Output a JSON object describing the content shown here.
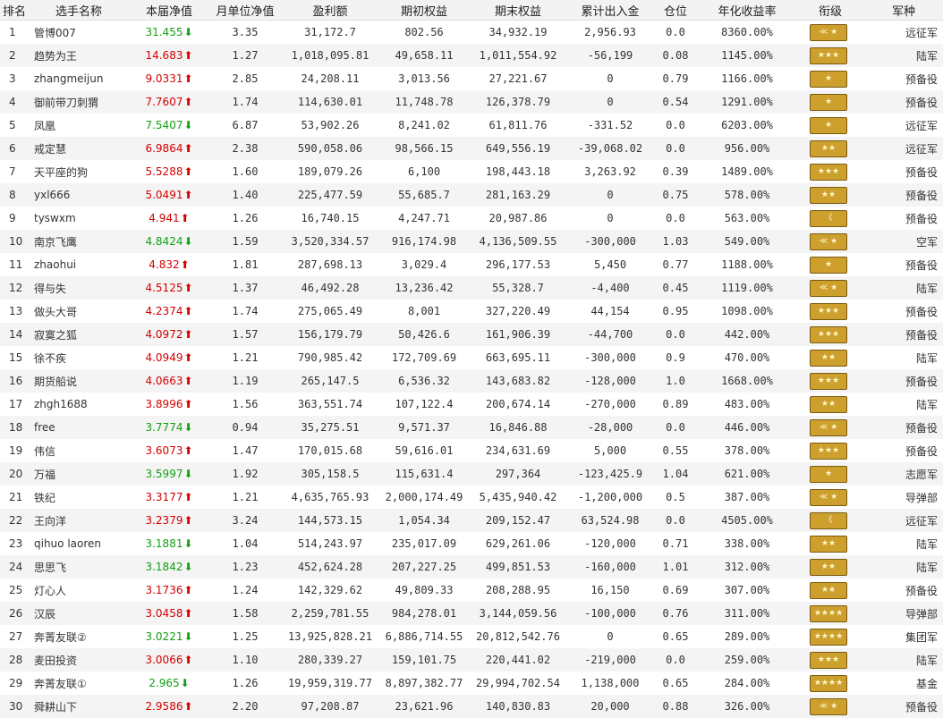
{
  "headers": [
    "排名",
    "选手名称",
    "本届净值",
    "月单位净值",
    "盈利额",
    "期初权益",
    "期末权益",
    "累计出入金",
    "仓位",
    "年化收益率",
    "衔级",
    "军种"
  ],
  "rows": [
    {
      "rank": "1",
      "name": "管博007",
      "nav": "31.455",
      "dir": "down",
      "arrow": "⬇",
      "unit": "3.35",
      "profit": "31,172.7",
      "start": "802.56",
      "end": "34,932.19",
      "cash": "2,956.93",
      "pos": "0.0",
      "annual": "8360.00%",
      "badge": "≪ ★",
      "branch": "远征军"
    },
    {
      "rank": "2",
      "name": "趋势为王",
      "nav": "14.683",
      "dir": "up",
      "arrow": "⬆",
      "unit": "1.27",
      "profit": "1,018,095.81",
      "start": "49,658.11",
      "end": "1,011,554.92",
      "cash": "-56,199",
      "pos": "0.08",
      "annual": "1145.00%",
      "badge": "★★★",
      "branch": "陆军"
    },
    {
      "rank": "3",
      "name": "zhangmeijun",
      "nav": "9.0331",
      "dir": "up",
      "arrow": "⬆",
      "unit": "2.85",
      "profit": "24,208.11",
      "start": "3,013.56",
      "end": "27,221.67",
      "cash": "0",
      "pos": "0.79",
      "annual": "1166.00%",
      "badge": "★",
      "branch": "预备役"
    },
    {
      "rank": "4",
      "name": "御前带刀刺猬",
      "nav": "7.7607",
      "dir": "up",
      "arrow": "⬆",
      "unit": "1.74",
      "profit": "114,630.01",
      "start": "11,748.78",
      "end": "126,378.79",
      "cash": "0",
      "pos": "0.54",
      "annual": "1291.00%",
      "badge": "★",
      "branch": "预备役"
    },
    {
      "rank": "5",
      "name": "凤凰",
      "nav": "7.5407",
      "dir": "down",
      "arrow": "⬇",
      "unit": "6.87",
      "profit": "53,902.26",
      "start": "8,241.02",
      "end": "61,811.76",
      "cash": "-331.52",
      "pos": "0.0",
      "annual": "6203.00%",
      "badge": "★",
      "branch": "远征军"
    },
    {
      "rank": "6",
      "name": "戒定慧",
      "nav": "6.9864",
      "dir": "up",
      "arrow": "⬆",
      "unit": "2.38",
      "profit": "590,058.06",
      "start": "98,566.15",
      "end": "649,556.19",
      "cash": "-39,068.02",
      "pos": "0.0",
      "annual": "956.00%",
      "badge": "★★",
      "branch": "远征军"
    },
    {
      "rank": "7",
      "name": "天平座的狗",
      "nav": "5.5288",
      "dir": "up",
      "arrow": "⬆",
      "unit": "1.60",
      "profit": "189,079.26",
      "start": "6,100",
      "end": "198,443.18",
      "cash": "3,263.92",
      "pos": "0.39",
      "annual": "1489.00%",
      "badge": "★★★",
      "branch": "预备役"
    },
    {
      "rank": "8",
      "name": "yxl666",
      "nav": "5.0491",
      "dir": "up",
      "arrow": "⬆",
      "unit": "1.40",
      "profit": "225,477.59",
      "start": "55,685.7",
      "end": "281,163.29",
      "cash": "0",
      "pos": "0.75",
      "annual": "578.00%",
      "badge": "★★",
      "branch": "预备役"
    },
    {
      "rank": "9",
      "name": "tyswxm",
      "nav": "4.941",
      "dir": "up",
      "arrow": "⬆",
      "unit": "1.26",
      "profit": "16,740.15",
      "start": "4,247.71",
      "end": "20,987.86",
      "cash": "0",
      "pos": "0.0",
      "annual": "563.00%",
      "badge": "《",
      "branch": "预备役"
    },
    {
      "rank": "10",
      "name": "南京飞鹰",
      "nav": "4.8424",
      "dir": "down",
      "arrow": "⬇",
      "unit": "1.59",
      "profit": "3,520,334.57",
      "start": "916,174.98",
      "end": "4,136,509.55",
      "cash": "-300,000",
      "pos": "1.03",
      "annual": "549.00%",
      "badge": "≪ ★",
      "branch": "空军"
    },
    {
      "rank": "11",
      "name": "zhaohui",
      "nav": "4.832",
      "dir": "up",
      "arrow": "⬆",
      "unit": "1.81",
      "profit": "287,698.13",
      "start": "3,029.4",
      "end": "296,177.53",
      "cash": "5,450",
      "pos": "0.77",
      "annual": "1188.00%",
      "badge": "★",
      "branch": "预备役"
    },
    {
      "rank": "12",
      "name": "得与失",
      "nav": "4.5125",
      "dir": "up",
      "arrow": "⬆",
      "unit": "1.37",
      "profit": "46,492.28",
      "start": "13,236.42",
      "end": "55,328.7",
      "cash": "-4,400",
      "pos": "0.45",
      "annual": "1119.00%",
      "badge": "≪ ★",
      "branch": "陆军"
    },
    {
      "rank": "13",
      "name": "做头大哥",
      "nav": "4.2374",
      "dir": "up",
      "arrow": "⬆",
      "unit": "1.74",
      "profit": "275,065.49",
      "start": "8,001",
      "end": "327,220.49",
      "cash": "44,154",
      "pos": "0.95",
      "annual": "1098.00%",
      "badge": "★★★",
      "branch": "预备役"
    },
    {
      "rank": "14",
      "name": "寂寞之狐",
      "nav": "4.0972",
      "dir": "up",
      "arrow": "⬆",
      "unit": "1.57",
      "profit": "156,179.79",
      "start": "50,426.6",
      "end": "161,906.39",
      "cash": "-44,700",
      "pos": "0.0",
      "annual": "442.00%",
      "badge": "★★★",
      "branch": "预备役"
    },
    {
      "rank": "15",
      "name": "徐不疾",
      "nav": "4.0949",
      "dir": "up",
      "arrow": "⬆",
      "unit": "1.21",
      "profit": "790,985.42",
      "start": "172,709.69",
      "end": "663,695.11",
      "cash": "-300,000",
      "pos": "0.9",
      "annual": "470.00%",
      "badge": "★★",
      "branch": "陆军"
    },
    {
      "rank": "16",
      "name": "期货船说",
      "nav": "4.0663",
      "dir": "up",
      "arrow": "⬆",
      "unit": "1.19",
      "profit": "265,147.5",
      "start": "6,536.32",
      "end": "143,683.82",
      "cash": "-128,000",
      "pos": "1.0",
      "annual": "1668.00%",
      "badge": "★★★",
      "branch": "预备役"
    },
    {
      "rank": "17",
      "name": "zhgh1688",
      "nav": "3.8996",
      "dir": "up",
      "arrow": "⬆",
      "unit": "1.56",
      "profit": "363,551.74",
      "start": "107,122.4",
      "end": "200,674.14",
      "cash": "-270,000",
      "pos": "0.89",
      "annual": "483.00%",
      "badge": "★★",
      "branch": "陆军"
    },
    {
      "rank": "18",
      "name": "free",
      "nav": "3.7774",
      "dir": "down",
      "arrow": "⬇",
      "unit": "0.94",
      "profit": "35,275.51",
      "start": "9,571.37",
      "end": "16,846.88",
      "cash": "-28,000",
      "pos": "0.0",
      "annual": "446.00%",
      "badge": "≪ ★",
      "branch": "预备役"
    },
    {
      "rank": "19",
      "name": "伟信",
      "nav": "3.6073",
      "dir": "up",
      "arrow": "⬆",
      "unit": "1.47",
      "profit": "170,015.68",
      "start": "59,616.01",
      "end": "234,631.69",
      "cash": "5,000",
      "pos": "0.55",
      "annual": "378.00%",
      "badge": "★★★",
      "branch": "预备役"
    },
    {
      "rank": "20",
      "name": "万福",
      "nav": "3.5997",
      "dir": "down",
      "arrow": "⬇",
      "unit": "1.92",
      "profit": "305,158.5",
      "start": "115,631.4",
      "end": "297,364",
      "cash": "-123,425.9",
      "pos": "1.04",
      "annual": "621.00%",
      "badge": "★",
      "branch": "志愿军"
    },
    {
      "rank": "21",
      "name": "铁纪",
      "nav": "3.3177",
      "dir": "up",
      "arrow": "⬆",
      "unit": "1.21",
      "profit": "4,635,765.93",
      "start": "2,000,174.49",
      "end": "5,435,940.42",
      "cash": "-1,200,000",
      "pos": "0.5",
      "annual": "387.00%",
      "badge": "≪ ★",
      "branch": "导弹部"
    },
    {
      "rank": "22",
      "name": "王向洋",
      "nav": "3.2379",
      "dir": "up",
      "arrow": "⬆",
      "unit": "3.24",
      "profit": "144,573.15",
      "start": "1,054.34",
      "end": "209,152.47",
      "cash": "63,524.98",
      "pos": "0.0",
      "annual": "4505.00%",
      "badge": "《",
      "branch": "远征军"
    },
    {
      "rank": "23",
      "name": "qihuo laoren",
      "nav": "3.1881",
      "dir": "down",
      "arrow": "⬇",
      "unit": "1.04",
      "profit": "514,243.97",
      "start": "235,017.09",
      "end": "629,261.06",
      "cash": "-120,000",
      "pos": "0.71",
      "annual": "338.00%",
      "badge": "★★",
      "branch": "陆军"
    },
    {
      "rank": "24",
      "name": "思思飞",
      "nav": "3.1842",
      "dir": "down",
      "arrow": "⬇",
      "unit": "1.23",
      "profit": "452,624.28",
      "start": "207,227.25",
      "end": "499,851.53",
      "cash": "-160,000",
      "pos": "1.01",
      "annual": "312.00%",
      "badge": "★★",
      "branch": "陆军"
    },
    {
      "rank": "25",
      "name": "灯心人",
      "nav": "3.1736",
      "dir": "up",
      "arrow": "⬆",
      "unit": "1.24",
      "profit": "142,329.62",
      "start": "49,809.33",
      "end": "208,288.95",
      "cash": "16,150",
      "pos": "0.69",
      "annual": "307.00%",
      "badge": "★★",
      "branch": "预备役"
    },
    {
      "rank": "26",
      "name": "汉辰",
      "nav": "3.0458",
      "dir": "up",
      "arrow": "⬆",
      "unit": "1.58",
      "profit": "2,259,781.55",
      "start": "984,278.01",
      "end": "3,144,059.56",
      "cash": "-100,000",
      "pos": "0.76",
      "annual": "311.00%",
      "badge": "★★★★",
      "branch": "导弹部"
    },
    {
      "rank": "27",
      "name": "奔菁友联②",
      "nav": "3.0221",
      "dir": "down",
      "arrow": "⬇",
      "unit": "1.25",
      "profit": "13,925,828.21",
      "start": "6,886,714.55",
      "end": "20,812,542.76",
      "cash": "0",
      "pos": "0.65",
      "annual": "289.00%",
      "badge": "★★★★",
      "branch": "集团军"
    },
    {
      "rank": "28",
      "name": "麦田投资",
      "nav": "3.0066",
      "dir": "up",
      "arrow": "⬆",
      "unit": "1.10",
      "profit": "280,339.27",
      "start": "159,101.75",
      "end": "220,441.02",
      "cash": "-219,000",
      "pos": "0.0",
      "annual": "259.00%",
      "badge": "★★★",
      "branch": "陆军"
    },
    {
      "rank": "29",
      "name": "奔菁友联①",
      "nav": "2.965",
      "dir": "down",
      "arrow": "⬇",
      "unit": "1.26",
      "profit": "19,959,319.77",
      "start": "8,897,382.77",
      "end": "29,994,702.54",
      "cash": "1,138,000",
      "pos": "0.65",
      "annual": "284.00%",
      "badge": "★★★★",
      "branch": "基金"
    },
    {
      "rank": "30",
      "name": "舜耕山下",
      "nav": "2.9586",
      "dir": "up",
      "arrow": "⬆",
      "unit": "2.20",
      "profit": "97,208.87",
      "start": "23,621.96",
      "end": "140,830.83",
      "cash": "20,000",
      "pos": "0.88",
      "annual": "326.00%",
      "badge": "≪ ★",
      "branch": "预备役"
    }
  ]
}
